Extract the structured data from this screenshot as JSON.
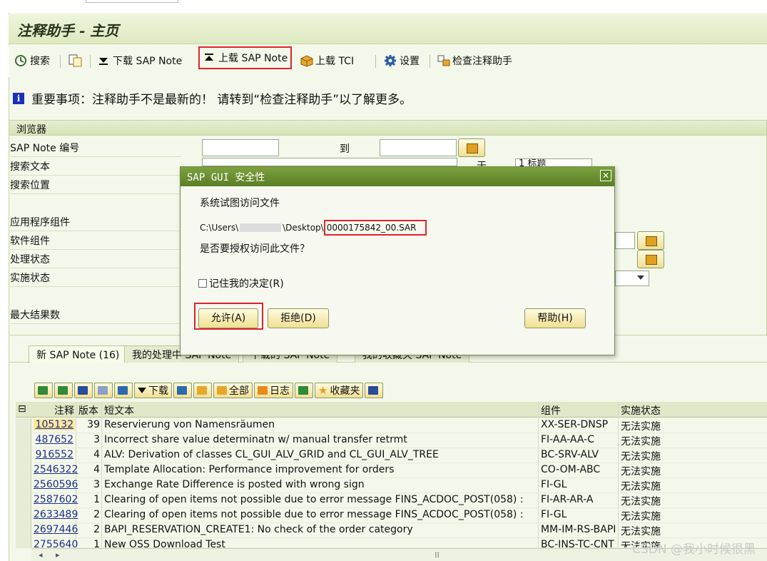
{
  "window": {
    "title": "注释助手 - 主页"
  },
  "toolbar": {
    "search": "搜索",
    "download": "下载 SAP Note",
    "upload_note": "上载 SAP Note",
    "upload_tci": "上载 TCI",
    "settings": "设置",
    "check": "检查注释助手"
  },
  "notice": "重要事项：注释助手不是最新的！ 请转到“检查注释助手”以了解更多。",
  "browser": {
    "title": "浏览器",
    "fields": {
      "note_no": "SAP Note 编号",
      "to": "到",
      "search_text": "搜索文本",
      "search_location": "搜索位置",
      "app_component": "应用程序组件",
      "sw_component": "软件组件",
      "proc_status": "处理状态",
      "impl_status": "实施状态",
      "max_results": "最大结果数",
      "in_label": "于",
      "in_value": "1 标题"
    }
  },
  "tabs": [
    {
      "label": "新 SAP Note (16)"
    },
    {
      "label": "我的处理中 SAP Note"
    },
    {
      "label": "下载的 SAP Note"
    },
    {
      "label": "我的收藏夹 SAP Note"
    }
  ],
  "alv": {
    "download": "下载",
    "all": "全部",
    "log": "日志",
    "favorites": "收藏夹"
  },
  "grid": {
    "headers": {
      "note": "注释",
      "version": "版本",
      "short_text": "短文本",
      "component": "组件",
      "impl_status": "实施状态"
    },
    "rows": [
      {
        "note": "105132",
        "version": "39",
        "text": "Reservierung von Namensräumen",
        "component": "XX-SER-DNSP",
        "status": "无法实施"
      },
      {
        "note": "487652",
        "version": "3",
        "text": "Incorrect share value determinatn w/ manual transfer retrmt",
        "component": "FI-AA-AA-C",
        "status": "无法实施"
      },
      {
        "note": "916552",
        "version": "4",
        "text": "ALV: Derivation of classes CL_GUI_ALV_GRID and CL_GUI_ALV_TREE",
        "component": "BC-SRV-ALV",
        "status": "无法实施"
      },
      {
        "note": "2546322",
        "version": "4",
        "text": "Template Allocation: Performance improvement for orders",
        "component": "CO-OM-ABC",
        "status": "无法实施"
      },
      {
        "note": "2560596",
        "version": "3",
        "text": "Exchange Rate Difference is posted with wrong sign",
        "component": "FI-GL",
        "status": "无法实施"
      },
      {
        "note": "2587602",
        "version": "1",
        "text": "Clearing of open items not possible due to error message FINS_ACDOC_POST(058) :",
        "component": "FI-AR-AR-A",
        "status": "无法实施"
      },
      {
        "note": "2633489",
        "version": "2",
        "text": "Clearing of open items not possible due to error message FINS_ACDOC_POST(058) :",
        "component": "FI-GL",
        "status": "无法实施"
      },
      {
        "note": "2697446",
        "version": "2",
        "text": "BAPI_RESERVATION_CREATE1: No check of the order category",
        "component": "MM-IM-RS-BAPI",
        "status": "无法实施"
      },
      {
        "note": "2755640",
        "version": "1",
        "text": "New OSS Download Test",
        "component": "BC-INS-TC-CNT",
        "status": "无法实施"
      }
    ]
  },
  "dialog": {
    "title": "SAP GUI 安全性",
    "line1": "系统试图访问文件",
    "path_prefix": "C:\\Users\\",
    "path_mid": "\\Desktop\\",
    "path_file": "0000175842_00.SAR",
    "question": "是否要授权访问此文件？",
    "remember": "记住我的决定(R)",
    "allow": "允许(A)",
    "deny": "拒绝(D)",
    "help": "帮助(H)"
  },
  "watermark": "CSDN @我小时候很黑"
}
